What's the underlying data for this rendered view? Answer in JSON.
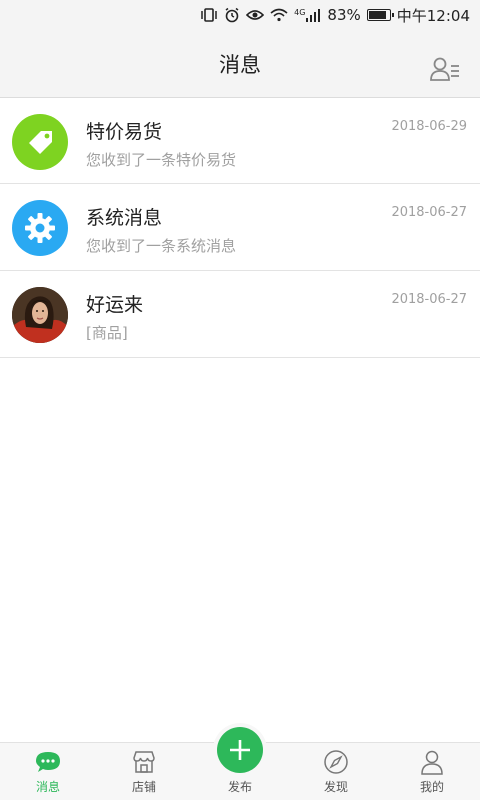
{
  "status_bar": {
    "battery": "83%",
    "time": "中午12:04",
    "network": "4G"
  },
  "header": {
    "title": "消息"
  },
  "messages": [
    {
      "name": "特价易货",
      "preview": "您收到了一条特价易货",
      "date": "2018-06-29",
      "icon": "tag-icon",
      "color": "#7ed321"
    },
    {
      "name": "系统消息",
      "preview": "您收到了一条系统消息",
      "date": "2018-06-27",
      "icon": "gear-icon",
      "color": "#2aa9f2"
    },
    {
      "name": "好运来",
      "preview": "[商品]",
      "date": "2018-06-27",
      "icon": "user-avatar"
    }
  ],
  "bottom_nav": {
    "items": [
      {
        "label": "消息",
        "icon": "chat-icon",
        "active": true
      },
      {
        "label": "店铺",
        "icon": "shop-icon"
      },
      {
        "label": "发布",
        "icon": "plus-icon"
      },
      {
        "label": "发现",
        "icon": "compass-icon"
      },
      {
        "label": "我的",
        "icon": "person-icon"
      }
    ]
  },
  "colors": {
    "accent": "#2db85a",
    "tag_green": "#7ed321",
    "gear_blue": "#2aa9f2"
  }
}
